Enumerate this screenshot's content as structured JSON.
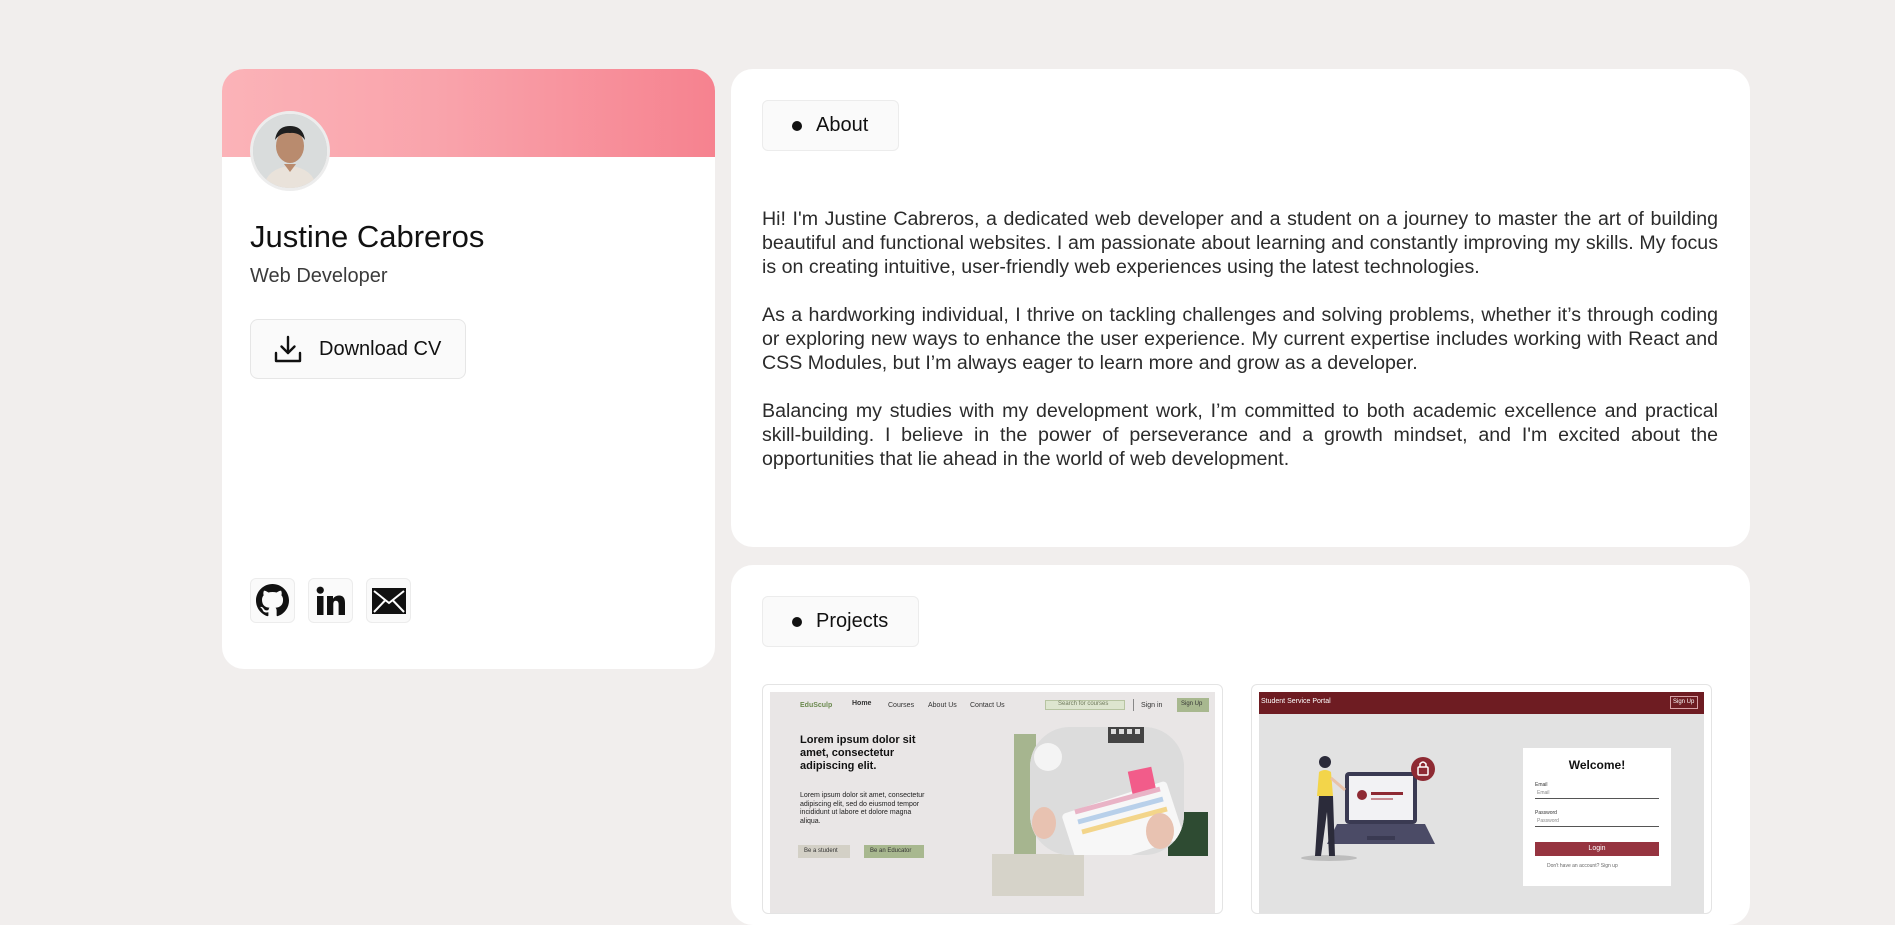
{
  "profile": {
    "name": "Justine Cabreros",
    "role": "Web Developer",
    "download_label": "Download CV",
    "socials": [
      {
        "icon": "github-icon"
      },
      {
        "icon": "linkedin-icon"
      },
      {
        "icon": "mail-icon"
      }
    ]
  },
  "about": {
    "title": "About",
    "paragraphs": [
      "Hi! I'm Justine Cabreros, a dedicated web developer and a student on a journey to master the art of building beautiful and functional websites. I am passionate about learning and constantly improving my skills. My focus is on creating intuitive, user-friendly web experiences using the latest technologies.",
      "As a hardworking individual, I thrive on tackling challenges and solving problems, whether it’s through coding or exploring new ways to enhance the user experience. My current expertise includes working with React and CSS Modules, but I’m always eager to learn more and grow as a developer.",
      "Balancing my studies with my development work, I’m committed to both academic excellence and practical skill-building. I believe in the power of perseverance and a growth mindset, and I'm excited about the opportunities that lie ahead in the world of web development."
    ]
  },
  "projects": {
    "title": "Projects",
    "project1": {
      "brand": "EduSculp",
      "nav": [
        "Home",
        "Courses",
        "About Us",
        "Contact Us"
      ],
      "search_placeholder": "Search for courses",
      "signin": "Sign in",
      "signup": "Sign Up",
      "headline": "Lorem ipsum dolor sit amet, consectetur adipiscing elit.",
      "body": "Lorem ipsum dolor sit amet, consectetur adipiscing elit, sed do eiusmod tempor incididunt ut labore et dolore magna aliqua.",
      "btn_student": "Be a student",
      "btn_educator": "Be an Educator"
    },
    "project2": {
      "header_title": "Student Service Portal",
      "header_btn": "Sign Up",
      "welcome": "Welcome!",
      "email_label": "Email",
      "email_placeholder": "Email",
      "password_label": "Password",
      "password_placeholder": "Password",
      "login_btn": "Login",
      "footer": "Don't have an account? Sign up"
    }
  },
  "colors": {
    "background": "#f1eeed",
    "banner_start": "#fbb3b8",
    "banner_end": "#f6828f",
    "portal_red": "#6e1c22",
    "login_btn": "#963440"
  }
}
